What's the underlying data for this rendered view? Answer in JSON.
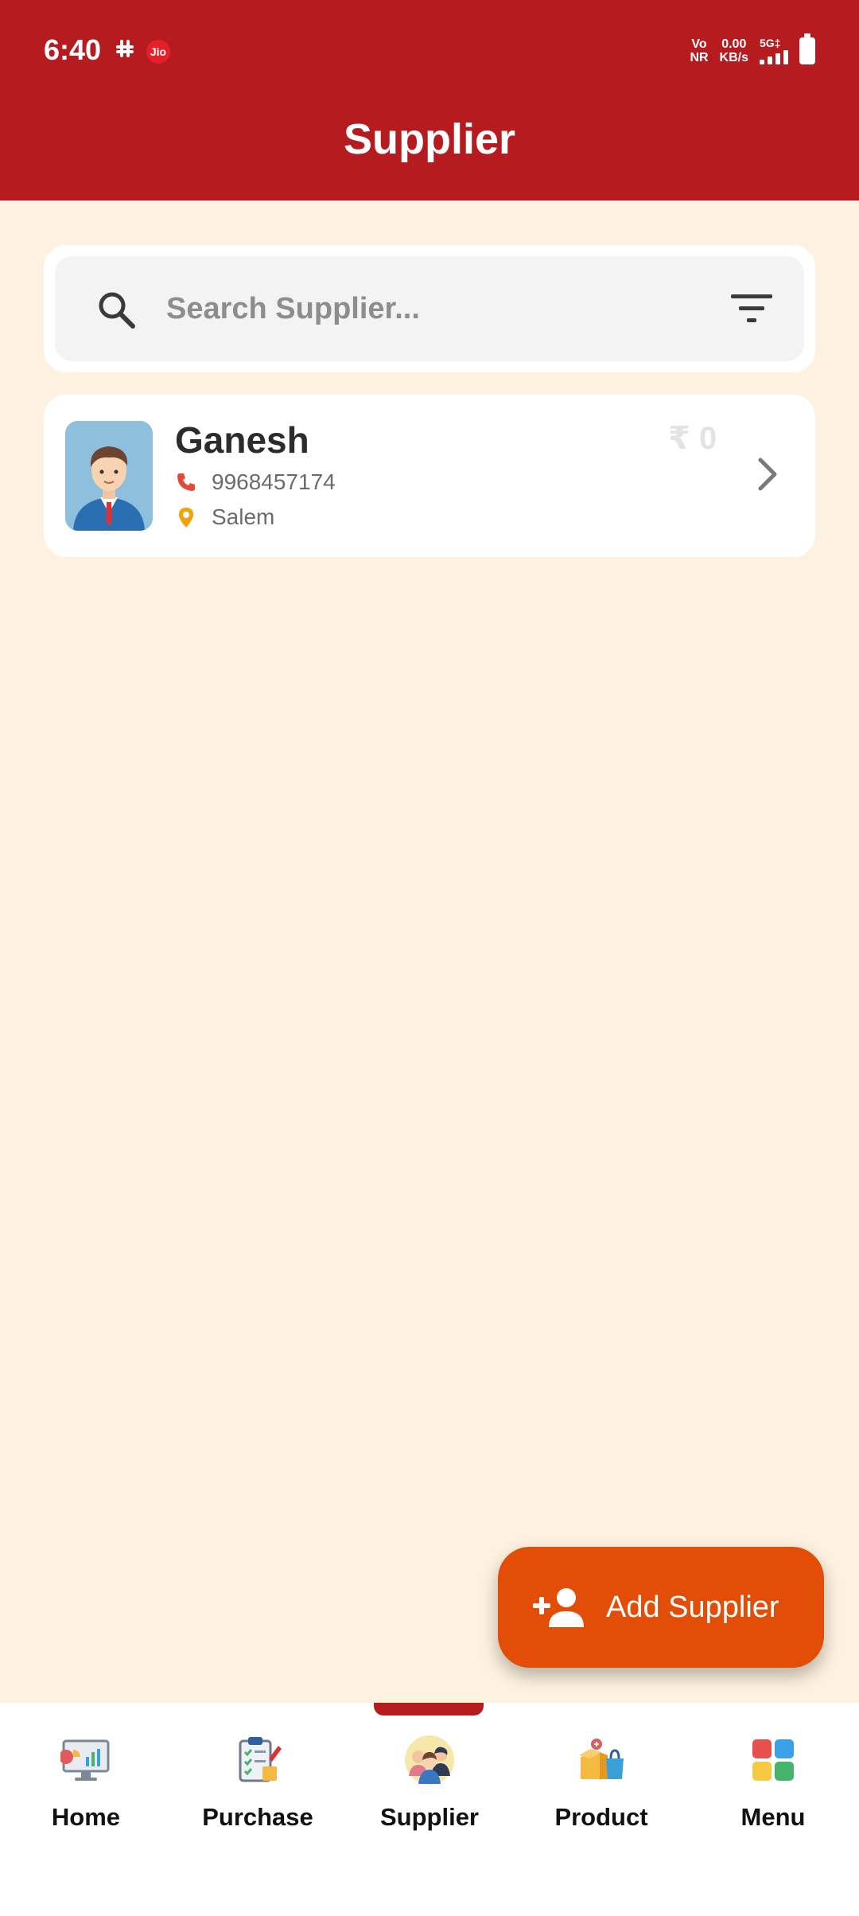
{
  "status_bar": {
    "time": "6:40",
    "carrier_badge": "Jio",
    "network_type": "Vo\nNR",
    "speed_value": "0.00",
    "speed_unit": "KB/s",
    "signal_label": "5G‡"
  },
  "header": {
    "title": "Supplier"
  },
  "search": {
    "placeholder": "Search Supplier...",
    "value": ""
  },
  "suppliers": [
    {
      "name": "Ganesh",
      "phone": "9968457174",
      "location": "Salem",
      "amount": "₹ 0"
    }
  ],
  "fab": {
    "label": "Add Supplier",
    "icon": "person-add-icon"
  },
  "bottom_nav": {
    "active": "Supplier",
    "items": [
      {
        "label": "Home",
        "icon": "dashboard-icon"
      },
      {
        "label": "Purchase",
        "icon": "clipboard-checklist-icon"
      },
      {
        "label": "Supplier",
        "icon": "people-group-icon"
      },
      {
        "label": "Product",
        "icon": "product-box-icon"
      },
      {
        "label": "Menu",
        "icon": "grid-menu-icon"
      }
    ]
  },
  "colors": {
    "header": "#b61c1f",
    "background": "#fdf1df",
    "fab": "#e24e08",
    "phone_icon": "#e14a3a",
    "location_icon": "#f2a20c"
  }
}
